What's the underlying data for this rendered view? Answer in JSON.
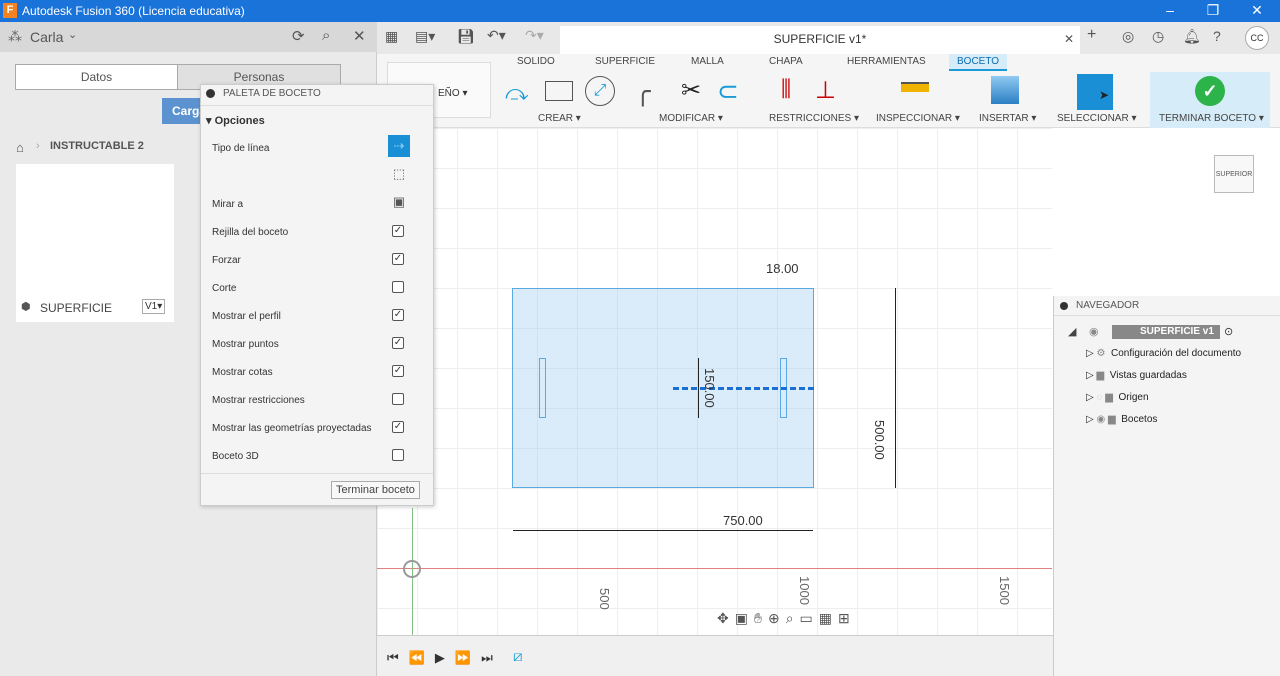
{
  "window": {
    "title": "Autodesk Fusion 360 (Licencia educativa)",
    "logo": "F"
  },
  "left_panel": {
    "user": "Carla",
    "tabs": [
      "Datos",
      "Personas"
    ],
    "upload_button": "Carga",
    "breadcrumb": "INSTRUCTABLE 2",
    "thumbnail_name": "SUPERFICIE",
    "version": "V1▾"
  },
  "document": {
    "tab_title": "SUPERFICIE v1*",
    "user_initials": "CC"
  },
  "ribbon": {
    "workspace": "EÑO ▾",
    "tabs": [
      "SOLIDO",
      "SUPERFICIE",
      "MALLA",
      "CHAPA",
      "HERRAMIENTAS",
      "BOCETO"
    ],
    "active_tab": "BOCETO",
    "accent": "#1a9bd7",
    "groups": [
      "CREAR ▾",
      "MODIFICAR ▾",
      "RESTRICCIONES ▾",
      "INSPECCIONAR ▾",
      "INSERTAR ▾",
      "SELECCIONAR ▾",
      "TERMINAR BOCETO ▾"
    ]
  },
  "palette": {
    "title": "PALETA DE BOCETO",
    "section": "Opciones",
    "rows": [
      {
        "label": "Tipo de línea",
        "type": "button"
      },
      {
        "label": "",
        "type": "button"
      },
      {
        "label": "Mirar a",
        "type": "button"
      },
      {
        "label": "Rejilla del boceto",
        "checked": true
      },
      {
        "label": "Forzar",
        "checked": true
      },
      {
        "label": "Corte",
        "checked": false
      },
      {
        "label": "Mostrar el perfil",
        "checked": true
      },
      {
        "label": "Mostrar puntos",
        "checked": true
      },
      {
        "label": "Mostrar cotas",
        "checked": true
      },
      {
        "label": "Mostrar restricciones",
        "checked": false
      },
      {
        "label": "Mostrar las geometrías proyectadas",
        "checked": true
      },
      {
        "label": "Boceto 3D",
        "checked": false
      }
    ],
    "finish_button": "Terminar boceto"
  },
  "sketch": {
    "dims": [
      "18.00",
      "150.00",
      "500.00",
      "750.00"
    ],
    "axis_ticks": [
      "500",
      "1000",
      "1500"
    ],
    "viewcube": "SUPERIOR"
  },
  "navigator": {
    "title": "NAVEGADOR",
    "root": "SUPERFICIE v1",
    "items": [
      "Configuración del documento",
      "Vistas guardadas",
      "Origen",
      "Bocetos"
    ]
  }
}
